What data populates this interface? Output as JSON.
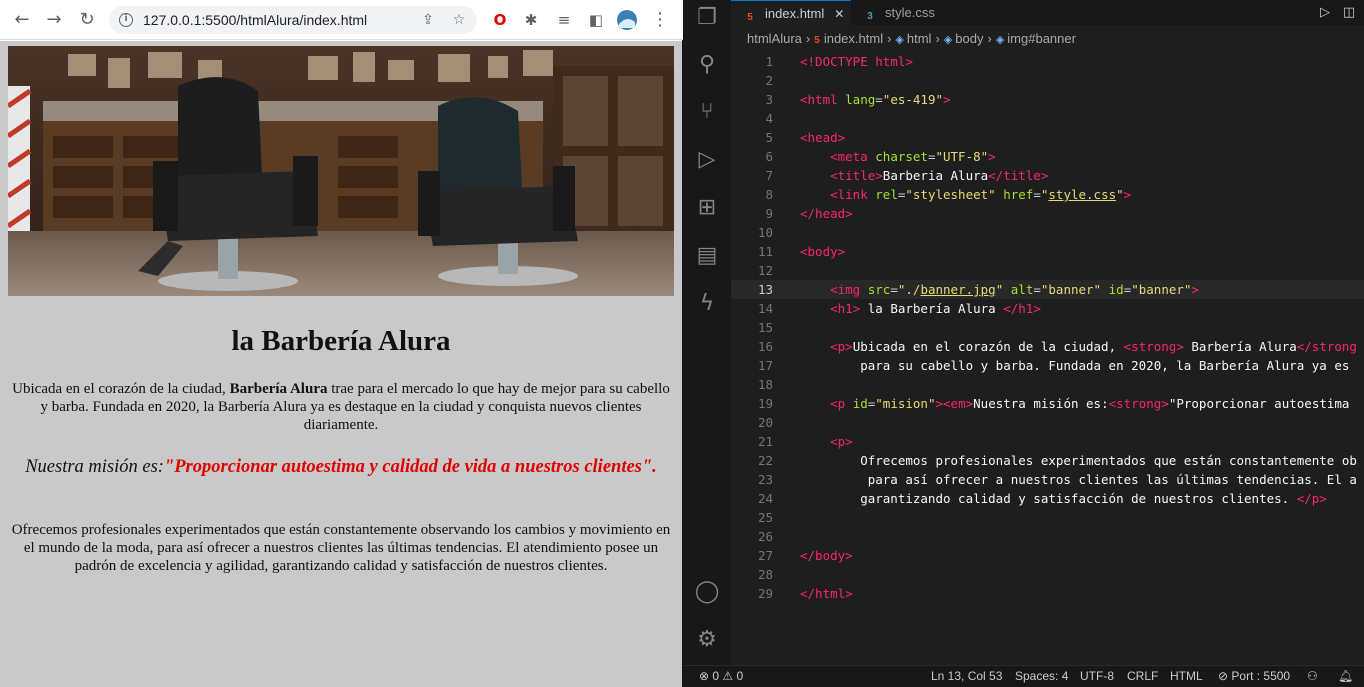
{
  "browser": {
    "url": "127.0.0.1:5500/htmlAlura/index.html",
    "page": {
      "banner_alt": "banner",
      "heading": "la Barbería Alura",
      "p1_before": "Ubicada en el corazón de la ciudad, ",
      "p1_strong": "Barbería Alura",
      "p1_after": " trae para el mercado lo que hay de mejor para su cabello y barba. Fundada en 2020, la Barbería Alura ya es destaque en la ciudad y conquista nuevos clientes diariamente.",
      "mision_em": "Nuestra misión es:",
      "mision_strong": "\"Proporcionar autoestima y calidad de vida a nuestros clientes\".",
      "p3": "Ofrecemos profesionales experimentados que están constantemente observando los cambios y movimiento en el mundo de la moda, para así ofrecer a nuestros clientes las últimas tendencias. El atendimiento posee un padrón de excelencia y agilidad, garantizando calidad y satisfacción de nuestros clientes."
    }
  },
  "vscode": {
    "tabs": [
      {
        "label": "index.html",
        "icon": "html5-icon"
      },
      {
        "label": "style.css",
        "icon": "css3-icon"
      }
    ],
    "breadcrumb": [
      "htmlAlura",
      "index.html",
      "html",
      "body",
      "img#banner"
    ],
    "current_line": 13,
    "lines": [
      {
        "n": "1",
        "tokens": [
          [
            "tg",
            "<!DOCTYPE html"
          ],
          [
            "tg",
            ">"
          ]
        ]
      },
      {
        "n": "2",
        "tokens": []
      },
      {
        "n": "3",
        "tokens": [
          [
            "tg",
            "<html "
          ],
          [
            "at",
            "lang"
          ],
          [
            "pu",
            "="
          ],
          [
            "st",
            "\"es-419\""
          ],
          [
            "tg",
            ">"
          ]
        ]
      },
      {
        "n": "4",
        "tokens": []
      },
      {
        "n": "5",
        "tokens": [
          [
            "tg",
            "<head"
          ],
          [
            "tg",
            ">"
          ]
        ]
      },
      {
        "n": "6",
        "tokens": [
          [
            "pu",
            "    "
          ],
          [
            "tg",
            "<meta "
          ],
          [
            "at",
            "charset"
          ],
          [
            "pu",
            "="
          ],
          [
            "st",
            "\"UTF-8\""
          ],
          [
            "tg",
            ">"
          ]
        ]
      },
      {
        "n": "7",
        "tokens": [
          [
            "pu",
            "    "
          ],
          [
            "tg",
            "<title"
          ],
          [
            "tg",
            ">"
          ],
          [
            "tx",
            "Barberia Alura"
          ],
          [
            "tg",
            "</title"
          ],
          [
            "tg",
            ">"
          ]
        ]
      },
      {
        "n": "8",
        "tokens": [
          [
            "pu",
            "    "
          ],
          [
            "tg",
            "<link "
          ],
          [
            "at",
            "rel"
          ],
          [
            "pu",
            "="
          ],
          [
            "st",
            "\"stylesheet\""
          ],
          [
            "pu",
            " "
          ],
          [
            "at",
            "href"
          ],
          [
            "pu",
            "="
          ],
          [
            "st",
            "\""
          ],
          [
            "stu",
            "style.css"
          ],
          [
            "st",
            "\""
          ],
          [
            "tg",
            ">"
          ]
        ]
      },
      {
        "n": "9",
        "tokens": [
          [
            "tg",
            "</head"
          ],
          [
            "tg",
            ">"
          ]
        ]
      },
      {
        "n": "10",
        "tokens": []
      },
      {
        "n": "11",
        "tokens": [
          [
            "tg",
            "<body"
          ],
          [
            "tg",
            ">"
          ]
        ]
      },
      {
        "n": "12",
        "tokens": []
      },
      {
        "n": "13",
        "tokens": [
          [
            "pu",
            "    "
          ],
          [
            "tg",
            "<img "
          ],
          [
            "at",
            "src"
          ],
          [
            "pu",
            "="
          ],
          [
            "st",
            "\"./"
          ],
          [
            "stu",
            "banner.jpg"
          ],
          [
            "st",
            "\""
          ],
          [
            "pu",
            " "
          ],
          [
            "at",
            "alt"
          ],
          [
            "pu",
            "="
          ],
          [
            "st",
            "\"banner\""
          ],
          [
            "pu",
            " "
          ],
          [
            "at",
            "id"
          ],
          [
            "pu",
            "="
          ],
          [
            "st",
            "\"banner\""
          ],
          [
            "tg",
            ">"
          ]
        ]
      },
      {
        "n": "14",
        "tokens": [
          [
            "pu",
            "    "
          ],
          [
            "tg",
            "<h1"
          ],
          [
            "tg",
            ">"
          ],
          [
            "tx",
            " la Barbería Alura "
          ],
          [
            "tg",
            "</h1"
          ],
          [
            "tg",
            ">"
          ]
        ]
      },
      {
        "n": "15",
        "tokens": []
      },
      {
        "n": "16",
        "tokens": [
          [
            "pu",
            "    "
          ],
          [
            "tg",
            "<p"
          ],
          [
            "tg",
            ">"
          ],
          [
            "tx",
            "Ubicada en el corazón de la ciudad, "
          ],
          [
            "tg",
            "<strong"
          ],
          [
            "tg",
            ">"
          ],
          [
            "tx",
            " Barbería Alura"
          ],
          [
            "tg",
            "</strong"
          ]
        ]
      },
      {
        "n": "17",
        "tokens": [
          [
            "tx",
            "        para su cabello y barba. Fundada en 2020, la Barbería Alura ya es"
          ]
        ]
      },
      {
        "n": "18",
        "tokens": []
      },
      {
        "n": "19",
        "tokens": [
          [
            "pu",
            "    "
          ],
          [
            "tg",
            "<p "
          ],
          [
            "at",
            "id"
          ],
          [
            "pu",
            "="
          ],
          [
            "st",
            "\"mision\""
          ],
          [
            "tg",
            ">"
          ],
          [
            "tg",
            "<em"
          ],
          [
            "tg",
            ">"
          ],
          [
            "tx",
            "Nuestra misión es:"
          ],
          [
            "tg",
            "<strong"
          ],
          [
            "tg",
            ">"
          ],
          [
            "tx",
            "\"Proporcionar autoestima"
          ]
        ]
      },
      {
        "n": "20",
        "tokens": []
      },
      {
        "n": "21",
        "tokens": [
          [
            "pu",
            "    "
          ],
          [
            "tg",
            "<p"
          ],
          [
            "tg",
            ">"
          ]
        ]
      },
      {
        "n": "22",
        "tokens": [
          [
            "tx",
            "        Ofrecemos profesionales experimentados que están constantemente ob"
          ]
        ]
      },
      {
        "n": "23",
        "tokens": [
          [
            "tx",
            "         para así ofrecer a nuestros clientes las últimas tendencias. El a"
          ]
        ]
      },
      {
        "n": "24",
        "tokens": [
          [
            "tx",
            "        garantizando calidad y satisfacción de nuestros clientes. "
          ],
          [
            "tg",
            "</p"
          ],
          [
            "tg",
            ">"
          ]
        ]
      },
      {
        "n": "25",
        "tokens": []
      },
      {
        "n": "26",
        "tokens": []
      },
      {
        "n": "27",
        "tokens": [
          [
            "tg",
            "</body"
          ],
          [
            "tg",
            ">"
          ]
        ]
      },
      {
        "n": "28",
        "tokens": []
      },
      {
        "n": "29",
        "tokens": [
          [
            "tg",
            "</html"
          ],
          [
            "tg",
            ">"
          ]
        ]
      }
    ],
    "status": {
      "errors": "0",
      "warnings": "0",
      "position": "Ln 13, Col 53",
      "spaces": "Spaces: 4",
      "encoding": "UTF-8",
      "eol": "CRLF",
      "language": "HTML",
      "port": "Port : 5500"
    }
  }
}
